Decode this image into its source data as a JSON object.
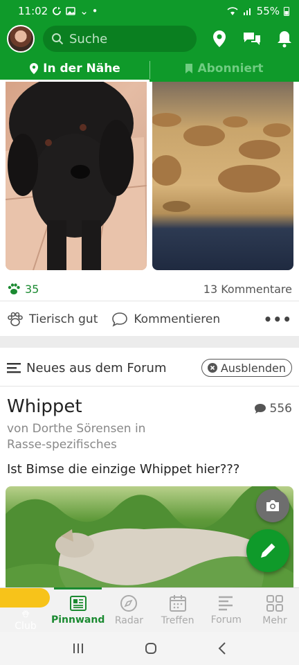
{
  "status_bar": {
    "time": "11:02",
    "battery": "55%"
  },
  "search": {
    "placeholder": "Suche"
  },
  "tabs": [
    {
      "label": "In der Nähe"
    },
    {
      "label": "Abonniert"
    }
  ],
  "post1": {
    "likes": "35",
    "comments": "13 Kommentare",
    "like_action": "Tierisch gut",
    "comment_action": "Kommentieren",
    "more": "•••"
  },
  "forum": {
    "section_title": "Neues aus dem Forum",
    "hide_label": "Ausblenden",
    "post_title": "Whippet",
    "comment_count": "556",
    "meta": "von Dorthe Sörensen in Rasse-spezifisches",
    "text": "Ist Bimse die einzige Whippet hier???"
  },
  "bottom_nav": [
    {
      "label": "Club",
      "icon": "paw-icon"
    },
    {
      "label": "Pinnwand",
      "icon": "newspaper-icon"
    },
    {
      "label": "Radar",
      "icon": "compass-icon"
    },
    {
      "label": "Treffen",
      "icon": "calendar-icon"
    },
    {
      "label": "Forum",
      "icon": "forum-icon"
    },
    {
      "label": "Mehr",
      "icon": "grid-icon"
    }
  ],
  "colors": {
    "brand_green": "#0f9a2a",
    "club_yellow": "#f7c31a"
  }
}
